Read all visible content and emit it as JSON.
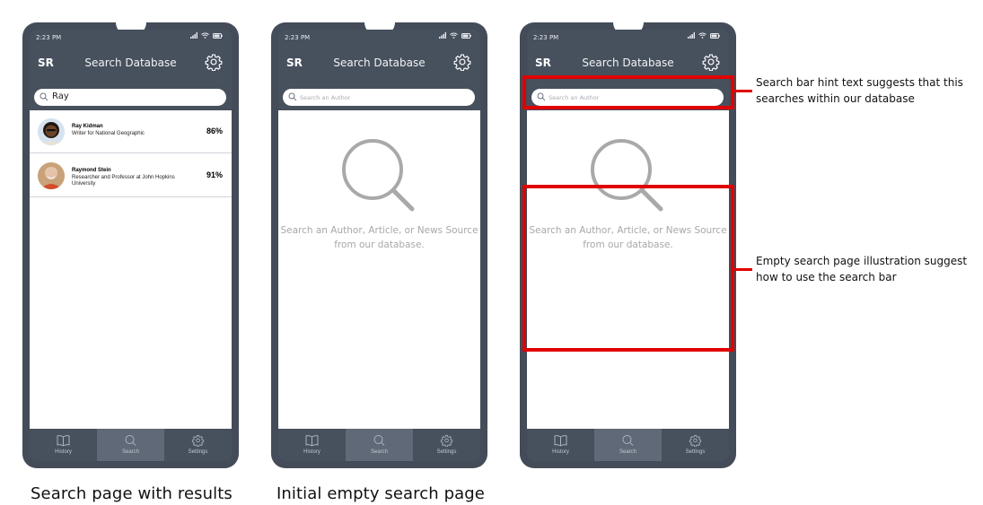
{
  "phones": [
    {
      "status_time": "2:23 PM",
      "logo": "SR",
      "title": "Search Database",
      "search_value": "Ray",
      "results": [
        {
          "name": "Ray Kidman",
          "desc": "Writer for National Geographic",
          "score": "86%"
        },
        {
          "name": "Raymond Stein",
          "desc": "Researcher and Professor at John Hopkins University",
          "score": "91%"
        }
      ],
      "tabs": [
        "History",
        "Search",
        "Settings"
      ],
      "caption": "Search page with results"
    },
    {
      "status_time": "2:23 PM",
      "logo": "SR",
      "title": "Search Database",
      "search_placeholder": "Search an Author",
      "empty_message": "Search an Author, Article, or News Source from our database.",
      "tabs": [
        "History",
        "Search",
        "Settings"
      ],
      "caption": "Initial empty search page"
    },
    {
      "status_time": "2:23 PM",
      "logo": "SR",
      "title": "Search Database",
      "search_placeholder": "Search an Author",
      "empty_message": "Search an Author, Article, or News Source from our database.",
      "tabs": [
        "History",
        "Search",
        "Settings"
      ]
    }
  ],
  "annotations": [
    "Search bar hint text suggests that this searches within our database",
    "Empty search page illustration suggest how to use the search bar"
  ],
  "colors": {
    "phone_body": "#434c58",
    "active_tab": "#5f6977",
    "highlight": "#e00000",
    "empty_text": "#a8a8a8"
  }
}
